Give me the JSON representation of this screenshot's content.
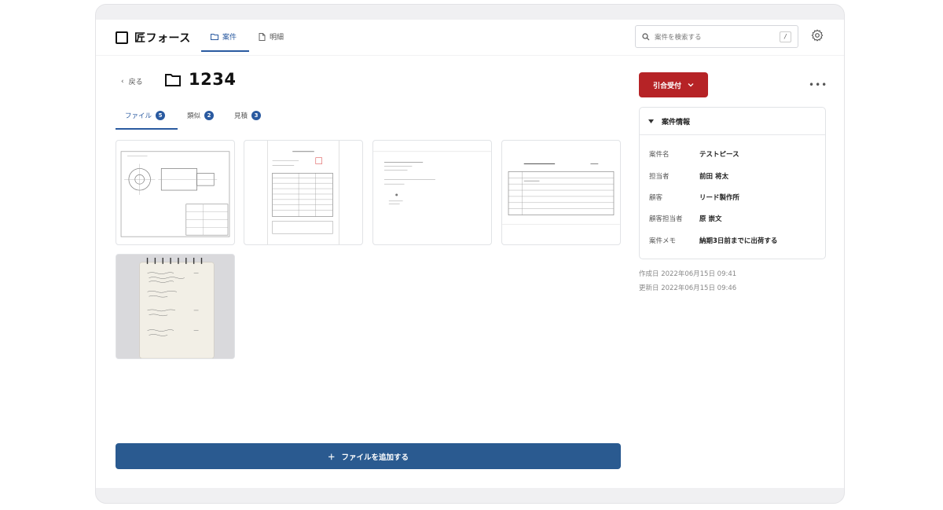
{
  "header": {
    "app_name": "匠フォース",
    "nav": [
      {
        "label": "案件",
        "icon": "folder-icon"
      },
      {
        "label": "明細",
        "icon": "document-icon"
      }
    ],
    "search_placeholder": "案件を検索する",
    "search_shortcut": "/"
  },
  "page": {
    "back_label": "戻る",
    "title": "1234"
  },
  "file_tabs": [
    {
      "label": "ファイル",
      "count": "5"
    },
    {
      "label": "類似",
      "count": "2"
    },
    {
      "label": "見積",
      "count": "3"
    }
  ],
  "files": [
    {
      "kind": "drawing",
      "name": "drawing-thumb"
    },
    {
      "kind": "invoice",
      "name": "invoice-thumb"
    },
    {
      "kind": "letter",
      "name": "letter-thumb"
    },
    {
      "kind": "form",
      "name": "form-thumb"
    },
    {
      "kind": "handwritten-notebook",
      "name": "notebook-thumb"
    }
  ],
  "add_file_label": "ファイルを追加する",
  "status_button": {
    "label": "引合受付",
    "color": "#b62326"
  },
  "info": {
    "heading": "案件情報",
    "rows": [
      {
        "key": "案件名",
        "value": "テストピース"
      },
      {
        "key": "担当者",
        "value": "前田 将太"
      },
      {
        "key": "顧客",
        "value": "リード製作所"
      },
      {
        "key": "顧客担当者",
        "value": "原 崇文"
      },
      {
        "key": "案件メモ",
        "value": "納期3日前までに出荷する"
      }
    ]
  },
  "meta": {
    "created": "作成日 2022年06月15日 09:41",
    "updated": "更新日 2022年06月15日 09:46"
  },
  "colors": {
    "accent": "#2a5aa0",
    "primary_button": "#2a5a90",
    "danger": "#b62326"
  }
}
